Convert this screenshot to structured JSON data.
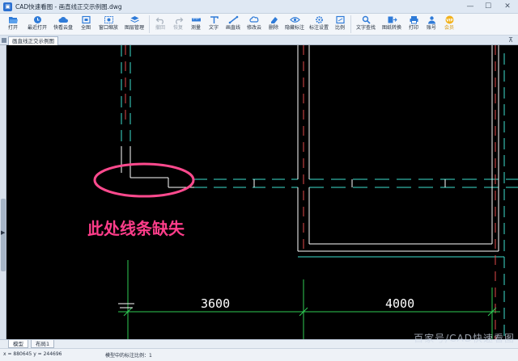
{
  "window": {
    "title": "CAD快速看图 - 画直线正交示例图.dwg",
    "minimize": "—",
    "maximize": "☐",
    "close": "✕"
  },
  "toolbar": {
    "open": "打开",
    "recent": "最近打开",
    "cloud": "快看云盘",
    "fullview": "全图",
    "window_zoom": "窗口缩放",
    "layer_manage": "图层管理",
    "undo": "撤回",
    "redo": "恢复",
    "measure": "测量",
    "text": "文字",
    "line": "画直线",
    "revision_cloud": "修改云",
    "delete": "删除",
    "hide_markup": "隐藏标注",
    "markup_settings": "标注设置",
    "compare": "比例",
    "text_search": "文字查找",
    "image_convert": "图纸转换",
    "print": "打印",
    "account": "账号",
    "vip": "会员",
    "vip_badge": "VIP"
  },
  "doc_tab": {
    "label": "画直线正交示例图",
    "pin": "⊼"
  },
  "annotation": {
    "text": "此处线条缺失",
    "color": "#ff3d8a"
  },
  "drawing": {
    "dim_left": "3600",
    "dim_right": "4000",
    "line_color": "#ffffff",
    "dash_color": "#00e0d0",
    "ellipse_color": "#ff4a8e"
  },
  "layout_tabs": {
    "model": "模型",
    "layout1": "布局1"
  },
  "status": {
    "coords": "x = 880645  y = 244696",
    "scale": "模型中的标注比例：1"
  },
  "watermark": "百家号/CAD快速看图"
}
